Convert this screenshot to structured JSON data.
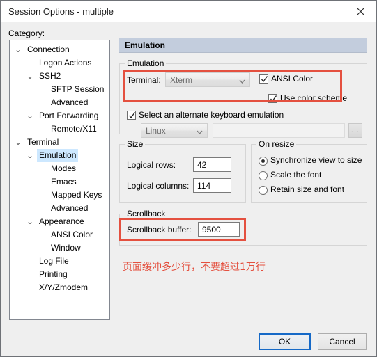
{
  "window": {
    "title": "Session Options - multiple",
    "close_icon": "close-icon"
  },
  "category": {
    "label": "Category:",
    "items": [
      {
        "label": "Connection",
        "level": 0,
        "twisty": "⌄",
        "selected": false
      },
      {
        "label": "Logon Actions",
        "level": 1,
        "twisty": "",
        "selected": false
      },
      {
        "label": "SSH2",
        "level": 1,
        "twisty": "⌄",
        "selected": false
      },
      {
        "label": "SFTP Session",
        "level": 2,
        "twisty": "",
        "selected": false
      },
      {
        "label": "Advanced",
        "level": 2,
        "twisty": "",
        "selected": false
      },
      {
        "label": "Port Forwarding",
        "level": 1,
        "twisty": "⌄",
        "selected": false
      },
      {
        "label": "Remote/X11",
        "level": 2,
        "twisty": "",
        "selected": false
      },
      {
        "label": "Terminal",
        "level": 0,
        "twisty": "⌄",
        "selected": false
      },
      {
        "label": "Emulation",
        "level": 1,
        "twisty": "⌄",
        "selected": true
      },
      {
        "label": "Modes",
        "level": 2,
        "twisty": "",
        "selected": false
      },
      {
        "label": "Emacs",
        "level": 2,
        "twisty": "",
        "selected": false
      },
      {
        "label": "Mapped Keys",
        "level": 2,
        "twisty": "",
        "selected": false
      },
      {
        "label": "Advanced",
        "level": 2,
        "twisty": "",
        "selected": false
      },
      {
        "label": "Appearance",
        "level": 1,
        "twisty": "⌄",
        "selected": false
      },
      {
        "label": "ANSI Color",
        "level": 2,
        "twisty": "",
        "selected": false
      },
      {
        "label": "Window",
        "level": 2,
        "twisty": "",
        "selected": false
      },
      {
        "label": "Log File",
        "level": 1,
        "twisty": "",
        "selected": false
      },
      {
        "label": "Printing",
        "level": 1,
        "twisty": "",
        "selected": false
      },
      {
        "label": "X/Y/Zmodem",
        "level": 1,
        "twisty": "",
        "selected": false
      }
    ]
  },
  "page": {
    "header": "Emulation",
    "emulation_group": {
      "legend": "Emulation",
      "terminal_label": "Terminal:",
      "terminal_value": "Xterm",
      "ansi_color_label": "ANSI Color",
      "ansi_color_checked": true,
      "use_color_scheme_label": "Use color scheme",
      "use_color_scheme_checked": true,
      "alt_keyboard_label": "Select an alternate keyboard emulation",
      "alt_keyboard_checked": true,
      "keyboard_value": "Linux",
      "keyboard_file_value": "",
      "browse_label": "..."
    },
    "size_group": {
      "legend": "Size",
      "rows_label": "Logical rows:",
      "rows_value": "42",
      "cols_label": "Logical columns:",
      "cols_value": "114"
    },
    "onresize_group": {
      "legend": "On resize",
      "options": [
        {
          "label": "Synchronize view to size",
          "selected": true
        },
        {
          "label": "Scale the font",
          "selected": false
        },
        {
          "label": "Retain size and font",
          "selected": false
        }
      ]
    },
    "scrollback_group": {
      "legend": "Scrollback",
      "buffer_label": "Scrollback buffer:",
      "buffer_value": "9500"
    },
    "annotation_note": "页面缓冲多少行，不要超过1万行"
  },
  "buttons": {
    "ok": "OK",
    "cancel": "Cancel"
  },
  "colors": {
    "annotation_red": "#e4503f",
    "section_header_bg": "#c3cddd",
    "selection_blue": "#cde8ff",
    "default_button_border": "#1569c7"
  }
}
